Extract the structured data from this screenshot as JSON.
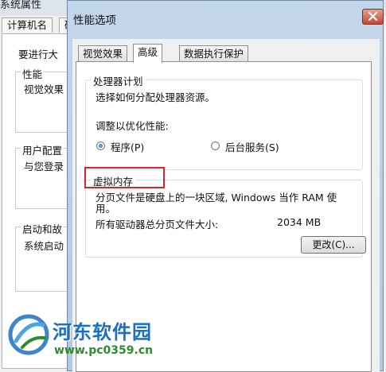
{
  "background_window": {
    "title_fragment": "系统属性",
    "tabs": [
      "计算机名",
      "硬件"
    ],
    "intro_text": "要进行大",
    "groups": [
      {
        "label": "性能",
        "text": "视觉效果"
      },
      {
        "label": "用户配置",
        "text": "与您登录"
      },
      {
        "label": "启动和故",
        "text": "系统启动"
      }
    ]
  },
  "dialog": {
    "title": "性能选项",
    "tabs": [
      {
        "label": "视觉效果",
        "active": false
      },
      {
        "label": "高级",
        "active": true
      },
      {
        "label": "数据执行保护",
        "active": false
      }
    ],
    "processor": {
      "group_label": "处理器计划",
      "description": "选择如何分配处理器资源。",
      "adjust_label": "调整以优化性能:",
      "options": [
        {
          "label": "程序(P)",
          "checked": true
        },
        {
          "label": "后台服务(S)",
          "checked": false
        }
      ]
    },
    "virtual_memory": {
      "group_label": "虚拟内存",
      "description_line1": "分页文件是硬盘上的一块区域, Windows 当作 RAM 使",
      "description_line2": "用。",
      "total_label": "所有驱动器总分页文件大小:",
      "total_value": "2034 MB",
      "change_button": "更改(C)..."
    }
  },
  "watermark": {
    "name": "河东软件园",
    "url": "www.pc0359.cn"
  },
  "colors": {
    "highlight": "#d9242b",
    "watermark_blue": "#1b6fc2",
    "watermark_green": "#2e8b2e"
  }
}
